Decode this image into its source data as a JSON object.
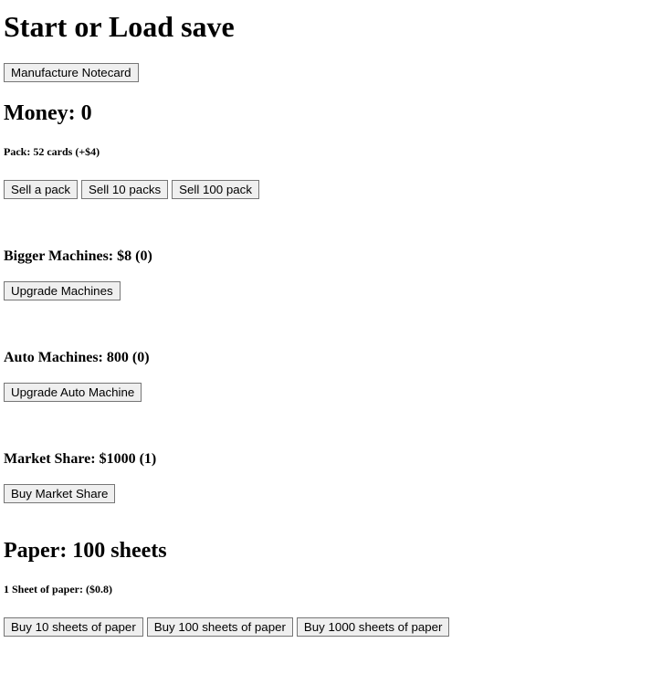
{
  "header": {
    "title": "Start or Load save"
  },
  "manufacture": {
    "button_label": "Manufacture Notecard"
  },
  "money": {
    "heading": "Money: 0"
  },
  "pack": {
    "info": "Pack: 52 cards (+$4)",
    "sell_one_label": "Sell a pack",
    "sell_ten_label": "Sell 10 packs",
    "sell_hundred_label": "Sell 100 pack"
  },
  "bigger_machines": {
    "heading": "Bigger Machines: $8 (0)",
    "button_label": "Upgrade Machines"
  },
  "auto_machines": {
    "heading": "Auto Machines: 800 (0)",
    "button_label": "Upgrade Auto Machine"
  },
  "market_share": {
    "heading": "Market Share: $1000 (1)",
    "button_label": "Buy Market Share"
  },
  "paper": {
    "heading": "Paper: 100 sheets",
    "price_info": "1 Sheet of paper: ($0.8)",
    "buy_ten_label": "Buy 10 sheets of paper",
    "buy_hundred_label": "Buy 100 sheets of paper",
    "buy_thousand_label": "Buy 1000 sheets of paper"
  }
}
